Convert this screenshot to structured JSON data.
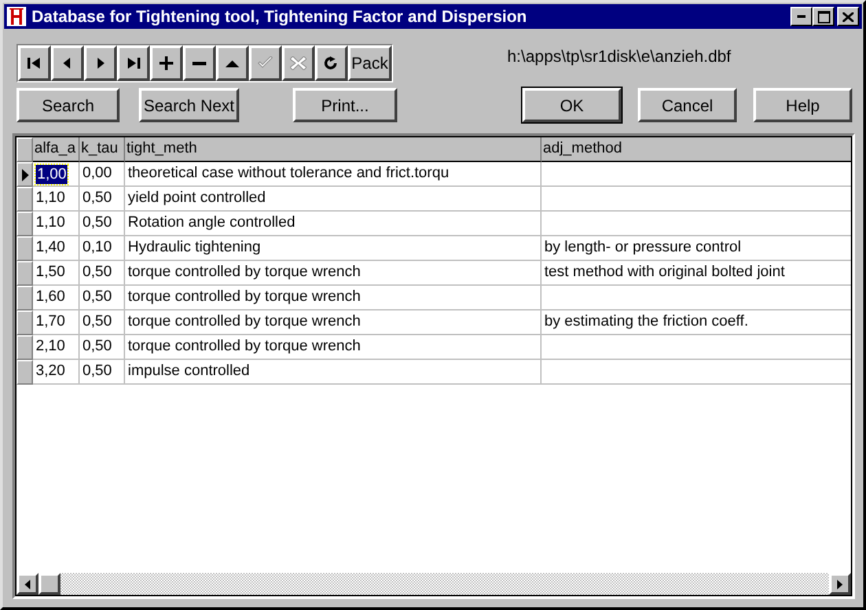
{
  "window": {
    "title": "Database for Tightening tool, Tightening Factor and Dispersion"
  },
  "navigator": [
    {
      "kind": "first",
      "disabled": false
    },
    {
      "kind": "prior",
      "disabled": false
    },
    {
      "kind": "next",
      "disabled": false
    },
    {
      "kind": "last",
      "disabled": false
    },
    {
      "kind": "insert",
      "disabled": false
    },
    {
      "kind": "delete",
      "disabled": false
    },
    {
      "kind": "edit",
      "disabled": false
    },
    {
      "kind": "post",
      "disabled": true
    },
    {
      "kind": "cancel",
      "disabled": true
    },
    {
      "kind": "refresh",
      "disabled": false
    },
    {
      "kind": "text",
      "label": "Pack",
      "disabled": false
    }
  ],
  "file_path": "h:\\apps\\tp\\sr1disk\\e\\anzieh.dbf",
  "left_buttons": [
    "Search",
    "Search Next",
    "Print..."
  ],
  "dialog_buttons": [
    {
      "label": "OK",
      "default": true
    },
    {
      "label": "Cancel",
      "default": false
    },
    {
      "label": "Help",
      "default": false
    }
  ],
  "table": {
    "columns": [
      "alfa_a",
      "k_tau",
      "tight_meth",
      "adj_method"
    ],
    "rows": [
      {
        "selected": true,
        "cells": [
          "1,00",
          "0,00",
          "theoretical case without tolerance and frict.torqu",
          ""
        ]
      },
      {
        "selected": false,
        "cells": [
          "1,10",
          "0,50",
          "yield point controlled",
          ""
        ]
      },
      {
        "selected": false,
        "cells": [
          "1,10",
          "0,50",
          "Rotation angle controlled",
          ""
        ]
      },
      {
        "selected": false,
        "cells": [
          "1,40",
          "0,10",
          "Hydraulic tightening",
          "by length- or pressure control"
        ]
      },
      {
        "selected": false,
        "cells": [
          "1,50",
          "0,50",
          "torque controlled by torque wrench",
          "test method with original bolted joint"
        ]
      },
      {
        "selected": false,
        "cells": [
          "1,60",
          "0,50",
          "torque controlled by torque wrench",
          ""
        ]
      },
      {
        "selected": false,
        "cells": [
          "1,70",
          "0,50",
          "torque controlled by torque wrench",
          "by estimating the friction coeff."
        ]
      },
      {
        "selected": false,
        "cells": [
          "2,10",
          "0,50",
          "torque controlled by torque wrench",
          ""
        ]
      },
      {
        "selected": false,
        "cells": [
          "3,20",
          "0,50",
          "impulse controlled",
          ""
        ]
      }
    ]
  }
}
